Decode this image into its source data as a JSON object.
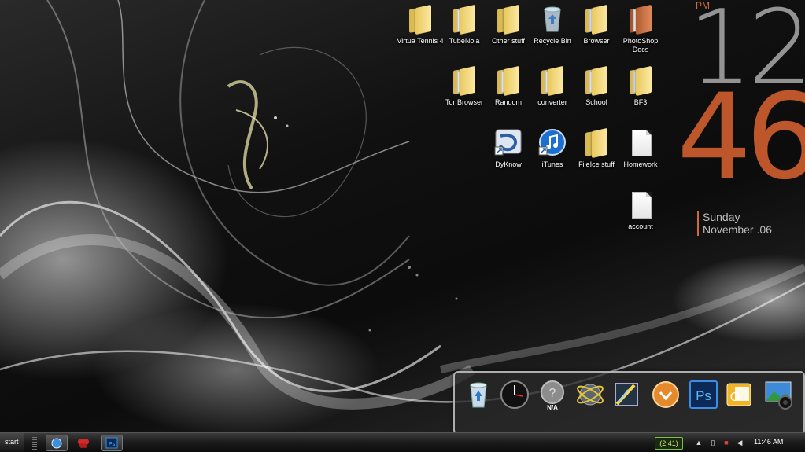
{
  "desktop_icons": [
    {
      "name": "folder-icon",
      "label": "Virtua Tennis 4"
    },
    {
      "name": "folder-icon",
      "label": "TubeNoia"
    },
    {
      "name": "folder-icon",
      "label": "Other stuff"
    },
    {
      "name": "recycle-bin-icon",
      "label": "Recycle Bin"
    },
    {
      "name": "folder-icon",
      "label": "Browser"
    },
    {
      "name": "folder-icon",
      "label": "PhotoShop Docs"
    },
    {
      "name": "folder-icon",
      "label": "Tor Browser"
    },
    {
      "name": "folder-icon",
      "label": "Random"
    },
    {
      "name": "folder-icon",
      "label": "converter"
    },
    {
      "name": "folder-icon",
      "label": "School"
    },
    {
      "name": "folder-icon",
      "label": "BF3"
    },
    {
      "name": "dyknow-icon",
      "label": "DyKnow"
    },
    {
      "name": "itunes-icon",
      "label": "iTunes"
    },
    {
      "name": "folder-icon",
      "label": "FileIce stuff"
    },
    {
      "name": "document-icon",
      "label": "Homework"
    },
    {
      "name": "document-icon",
      "label": "account"
    }
  ],
  "clock_gadget": {
    "ampm": "PM",
    "hours": "12",
    "minutes": "46",
    "day": "Sunday",
    "date": "November .06"
  },
  "dock": {
    "items": [
      {
        "name": "recycle-bin-icon",
        "text": ""
      },
      {
        "name": "clock-icon",
        "text": ""
      },
      {
        "name": "weather-icon",
        "text": "N/A"
      },
      {
        "name": "network-globe-icon",
        "text": ""
      },
      {
        "name": "drawing-app-icon",
        "text": ""
      },
      {
        "name": "download-app-icon",
        "text": ""
      },
      {
        "name": "photoshop-icon",
        "text": "Ps"
      },
      {
        "name": "outlook-icon",
        "text": "O"
      },
      {
        "name": "camera-photo-icon",
        "text": ""
      }
    ]
  },
  "taskbar": {
    "start_label": "start",
    "tasks": [
      {
        "name": "browser-task-icon"
      },
      {
        "name": "butterfly-task-icon"
      },
      {
        "name": "photoshop-task-icon",
        "text": "Ps"
      }
    ],
    "tray": {
      "battery": "(2:41)",
      "time": "11:46 AM"
    }
  },
  "colors": {
    "clock_accent": "#d0693a",
    "clock_hours": "#aaaaaa"
  }
}
